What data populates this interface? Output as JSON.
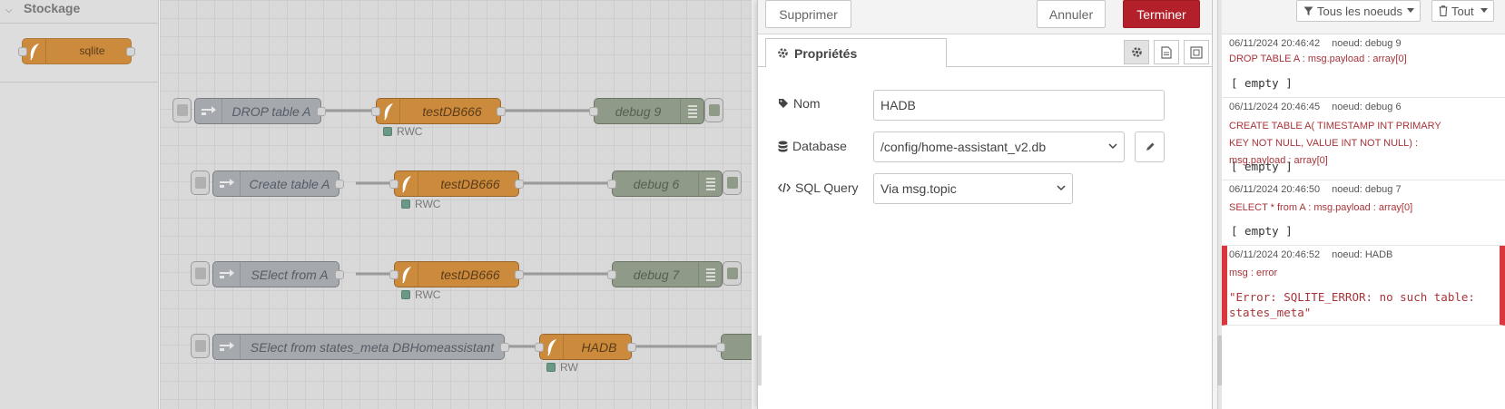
{
  "palette": {
    "category": "Stockage",
    "nodes": [
      {
        "label": "sqlite"
      }
    ]
  },
  "flow": {
    "rows": [
      {
        "inject": "DROP table A",
        "sqlite": "testDB666",
        "status": "RWC",
        "debug": "debug 9"
      },
      {
        "inject": "Create table A",
        "sqlite": "testDB666",
        "status": "RWC",
        "debug": "debug 6"
      },
      {
        "inject": "SElect from A",
        "sqlite": "testDB666",
        "status": "RWC",
        "debug": "debug 7"
      },
      {
        "inject": "SElect from states_meta DBHomeassistant",
        "sqlite": "HADB",
        "status": "RW",
        "debug": ""
      }
    ]
  },
  "editor": {
    "delete_label": "Supprimer",
    "cancel_label": "Annuler",
    "done_label": "Terminer",
    "tab_label": "Propriétés",
    "fields": {
      "name": {
        "label": "Nom",
        "value": "HADB"
      },
      "database": {
        "label": "Database",
        "value": "/config/home-assistant_v2.db"
      },
      "sql_query": {
        "label": "SQL Query",
        "value": "Via msg.topic"
      }
    }
  },
  "debug": {
    "filter_nodes_label": "Tous les noeuds",
    "filter_all_label": "Tout",
    "messages": [
      {
        "time": "06/11/2024 20:46:42",
        "node": "noeud: debug 9",
        "topic": "DROP TABLE A : msg.payload : array[0]",
        "value": "[ empty ]",
        "error": false
      },
      {
        "time": "06/11/2024 20:46:45",
        "node": "noeud: debug 6",
        "topic": "CREATE TABLE A( TIMESTAMP INT PRIMARY KEY NOT NULL, VALUE INT NOT NULL) : msg.payload : array[0]",
        "value": "[ empty ]",
        "error": false
      },
      {
        "time": "06/11/2024 20:46:50",
        "node": "noeud: debug 7",
        "topic": "SELECT * from A : msg.payload : array[0]",
        "value": "[ empty ]",
        "error": false
      },
      {
        "time": "06/11/2024 20:46:52",
        "node": "noeud: HADB",
        "topic": "msg : error",
        "value": "\"Error: SQLITE_ERROR: no such table: states_meta\"",
        "error": true
      }
    ]
  },
  "colors": {
    "sqlite_node": "#cc8a3c",
    "inject_node": "#a5a9ae",
    "debug_node": "#8f9b88",
    "primary_button": "#b3202a",
    "error_accent": "#d9373d"
  },
  "icons": [
    "chevron-down-icon",
    "feather-icon",
    "inject-arrow-icon",
    "list-icon",
    "gear-icon",
    "document-icon",
    "frame-icon",
    "tag-icon",
    "database-icon",
    "code-icon",
    "pencil-icon",
    "filter-icon",
    "trash-icon"
  ]
}
